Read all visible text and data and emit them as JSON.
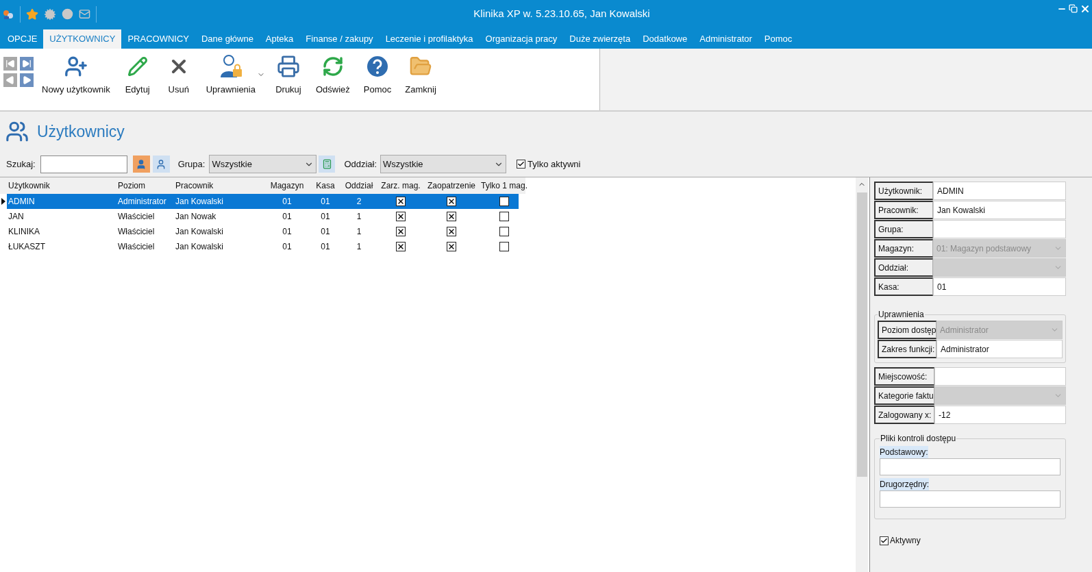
{
  "window": {
    "title": "Klinika XP w. 5.23.10.65, Jan Kowalski"
  },
  "menu_tabs": [
    {
      "label": "OPCJE",
      "selected": false
    },
    {
      "label": "UŻYTKOWNICY",
      "selected": true
    },
    {
      "label": "PRACOWNICY",
      "selected": false
    },
    {
      "label": "Dane główne",
      "selected": false
    },
    {
      "label": "Apteka",
      "selected": false
    },
    {
      "label": "Finanse / zakupy",
      "selected": false
    },
    {
      "label": "Leczenie i profilaktyka",
      "selected": false
    },
    {
      "label": "Organizacja pracy",
      "selected": false
    },
    {
      "label": "Duże zwierzęta",
      "selected": false
    },
    {
      "label": "Dodatkowe",
      "selected": false
    },
    {
      "label": "Administrator",
      "selected": false
    },
    {
      "label": "Pomoc",
      "selected": false
    }
  ],
  "toolbar": {
    "buttons": [
      {
        "label": "Nowy użytkownik",
        "kind": "new_user",
        "dropdown": false
      },
      {
        "label": "Edytuj",
        "kind": "edit",
        "dropdown": false
      },
      {
        "label": "Usuń",
        "kind": "delete",
        "dropdown": false
      },
      {
        "label": "Uprawnienia",
        "kind": "permissions",
        "dropdown": true
      },
      {
        "label": "Drukuj",
        "kind": "print",
        "dropdown": false
      },
      {
        "label": "Odśwież",
        "kind": "refresh",
        "dropdown": false
      },
      {
        "label": "Pomoc",
        "kind": "help",
        "dropdown": false
      },
      {
        "label": "Zamknij",
        "kind": "close",
        "dropdown": false
      }
    ]
  },
  "page": {
    "title": "Użytkownicy"
  },
  "filters": {
    "search_label": "Szukaj:",
    "group": {
      "label": "Grupa:",
      "value": "Wszystkie"
    },
    "branch": {
      "label": "Oddział:",
      "value": "Wszystkie"
    },
    "active_only": {
      "label": "Tylko aktywni",
      "checked": true
    }
  },
  "table": {
    "columns": [
      "Użytkownik",
      "Poziom",
      "Pracownik",
      "Magazyn",
      "Kasa",
      "Oddział",
      "Zarz. mag.",
      "Zaopatrzenie",
      "Tylko 1 mag."
    ],
    "rows": [
      {
        "cells": [
          "ADMIN",
          "Administrator",
          "Jan Kowalski",
          "01",
          "01",
          "2"
        ],
        "checks": [
          true,
          true,
          false
        ],
        "selected": true
      },
      {
        "cells": [
          "JAN",
          "Właściciel",
          "Jan Nowak",
          "01",
          "01",
          "1"
        ],
        "checks": [
          true,
          true,
          false
        ],
        "selected": false
      },
      {
        "cells": [
          "KLINIKA",
          "Właściciel",
          "Jan Kowalski",
          "01",
          "01",
          "1"
        ],
        "checks": [
          true,
          true,
          false
        ],
        "selected": false
      },
      {
        "cells": [
          "ŁUKASZT",
          "Właściciel",
          "Jan Kowalski",
          "01",
          "01",
          "1"
        ],
        "checks": [
          true,
          true,
          false
        ],
        "selected": false
      }
    ]
  },
  "details": {
    "fields": [
      {
        "label": "Użytkownik:",
        "value": "ADMIN",
        "kind": "text",
        "disabled": false
      },
      {
        "label": "Pracownik:",
        "value": "Jan Kowalski",
        "kind": "text",
        "disabled": false
      },
      {
        "label": "Grupa:",
        "kind": "text",
        "disabled": false
      },
      {
        "label": "Magazyn:",
        "value": "01: Magazyn podstawowy",
        "kind": "select",
        "disabled": true
      },
      {
        "label": "Oddział:",
        "kind": "select",
        "disabled": true
      },
      {
        "label": "Kasa:",
        "value": "01",
        "kind": "text",
        "disabled": false
      }
    ],
    "permissions": {
      "title": "Uprawnienia",
      "fields": [
        {
          "label": "Poziom dostęp",
          "value": "Administrator",
          "kind": "select",
          "disabled": true
        },
        {
          "label": "Zakres funkcji:",
          "value": "Administrator",
          "kind": "text",
          "disabled": false
        }
      ]
    },
    "extra_fields": [
      {
        "label": "Miejscowość:",
        "kind": "text",
        "disabled": false
      },
      {
        "label": "Kategorie faktu",
        "kind": "select",
        "disabled": true
      },
      {
        "label": "Zalogowany x:",
        "value": "-12",
        "kind": "text",
        "disabled": false
      }
    ],
    "access_files": {
      "title": "Pliki kontroli dostępu",
      "fields": [
        {
          "label": "Podstawowy:"
        },
        {
          "label": "Drugorzędny:"
        }
      ]
    },
    "active": {
      "label": "Aktywny",
      "checked": true
    }
  }
}
